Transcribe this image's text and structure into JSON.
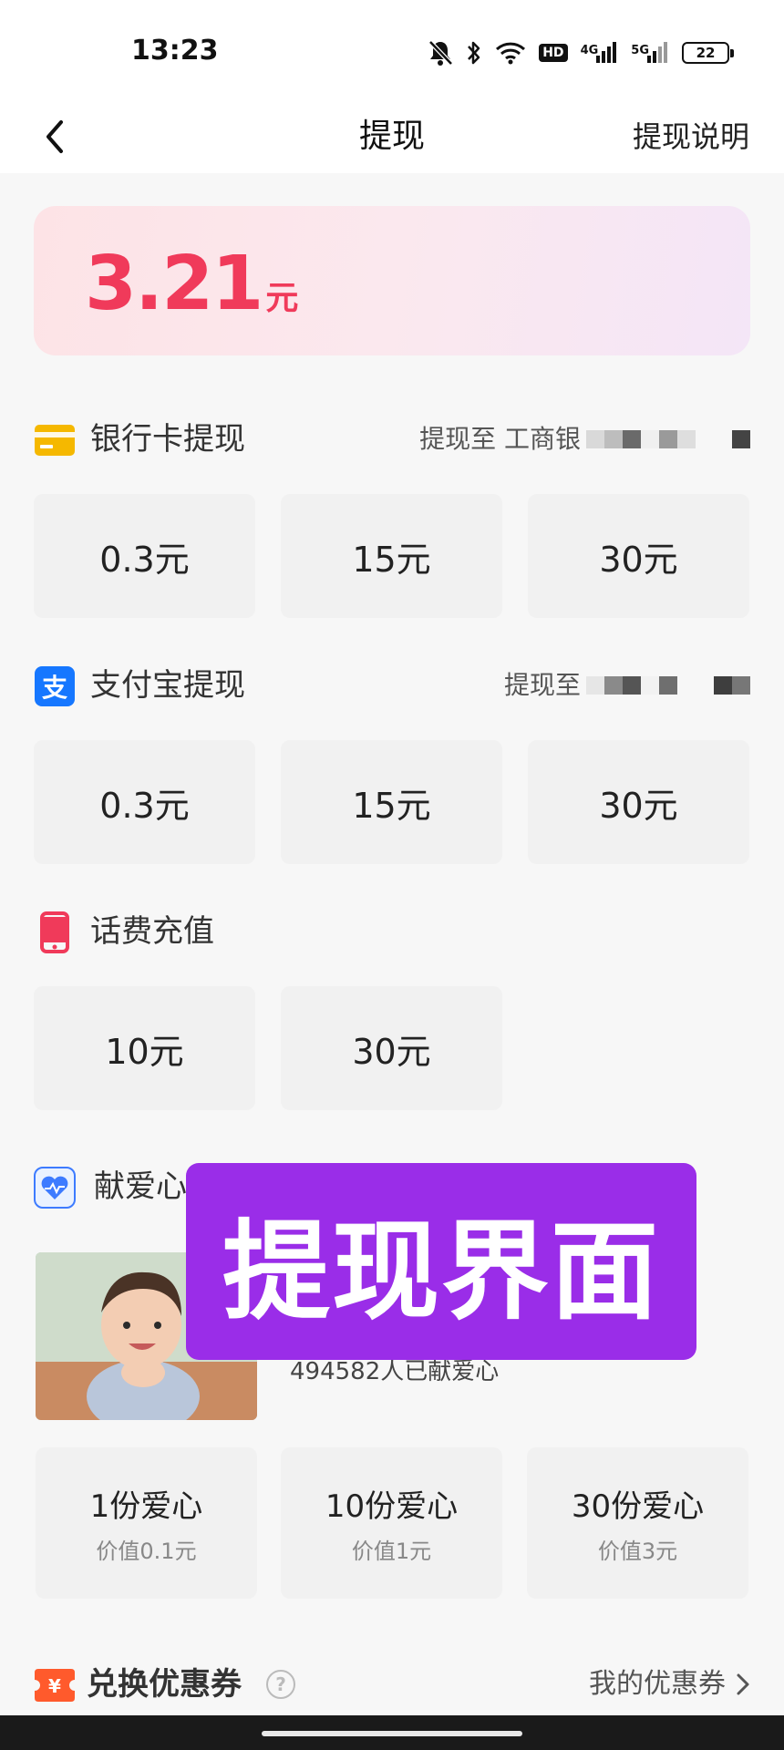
{
  "status_bar": {
    "time": "13:23",
    "hd_badge": "HD",
    "net1": "4G",
    "net2": "5G",
    "battery": "22"
  },
  "nav": {
    "title": "提现",
    "right": "提现说明"
  },
  "balance": {
    "amount": "3.21",
    "unit": "元"
  },
  "bank": {
    "title": "银行卡提现",
    "dest": "提现至 工商银",
    "options": [
      "0.3元",
      "15元",
      "30元"
    ]
  },
  "alipay": {
    "title": "支付宝提现",
    "dest": "提现至",
    "options": [
      "0.3元",
      "15元",
      "30元"
    ]
  },
  "phone": {
    "title": "话费充值",
    "options": [
      "10元",
      "30元"
    ]
  },
  "charity": {
    "title": "献爱心",
    "count": "494582人已献爱心",
    "options": [
      {
        "main": "1份爱心",
        "sub": "价值0.1元"
      },
      {
        "main": "10份爱心",
        "sub": "价值1元"
      },
      {
        "main": "30份爱心",
        "sub": "价值3元"
      }
    ]
  },
  "overlay": {
    "text": "提现界面"
  },
  "coupon": {
    "title": "兑换优惠券",
    "help": "?",
    "link": "我的优惠券"
  },
  "colors": {
    "accent_red": "#f03a5a",
    "alipay_blue": "#1677ff",
    "bank_yellow": "#f5b800",
    "overlay_purple": "#9a2de8",
    "coupon_orange": "#ff5a2c"
  }
}
